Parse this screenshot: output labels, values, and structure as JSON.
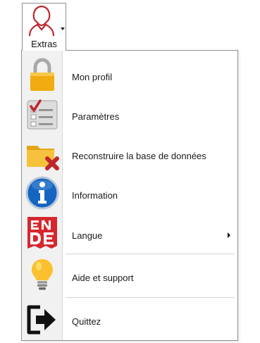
{
  "extras_button": {
    "label": "Extras",
    "icon": "user-silhouette-icon"
  },
  "menu": {
    "items": [
      {
        "label": "Mon profil",
        "icon": "padlock-icon"
      },
      {
        "label": "Paramètres",
        "icon": "checklist-icon"
      },
      {
        "label": "Reconstruire la base de données",
        "icon": "folder-delete-icon"
      },
      {
        "label": "Information",
        "icon": "info-icon"
      },
      {
        "label": "Langue",
        "icon": "flag-language-icon",
        "has_submenu": true
      },
      {
        "label": "Aide et support",
        "icon": "lightbulb-icon"
      },
      {
        "label": "Quittez",
        "icon": "exit-icon"
      }
    ]
  },
  "colors": {
    "accent": "#c0272d",
    "info_blue": "#1565c0",
    "lock_gold": "#f0ac10",
    "bulb_yellow": "#fbc02d"
  }
}
